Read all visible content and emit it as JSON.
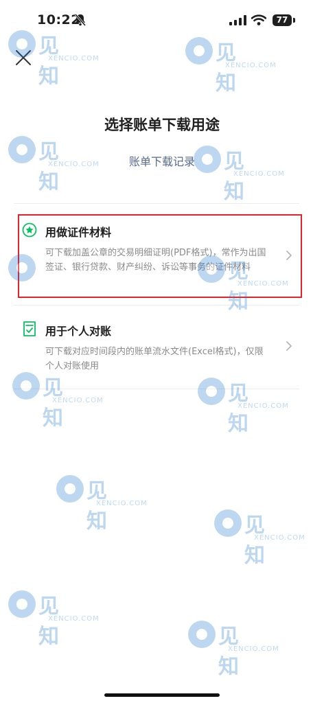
{
  "status_bar": {
    "time": "10:22",
    "battery": "77"
  },
  "header": {
    "title": "选择账单下载用途",
    "history_link": "账单下载记录"
  },
  "options": [
    {
      "title": "用做证件材料",
      "description": "可下载加盖公章的交易明细证明(PDF格式)，常作为出国签证、银行贷款、财产纠纷、诉讼等事务的证件材料",
      "icon": "star-badge-icon"
    },
    {
      "title": "用于个人对账",
      "description": "可下载对应时间段内的账单流水文件(Excel格式)，仅限个人对账使用",
      "icon": "document-check-icon"
    }
  ],
  "watermark": {
    "brand": "见知",
    "site": "XENCIO.COM"
  },
  "colors": {
    "accent_green": "#07c160",
    "link": "#566a8f",
    "highlight_red": "#e5212a"
  }
}
